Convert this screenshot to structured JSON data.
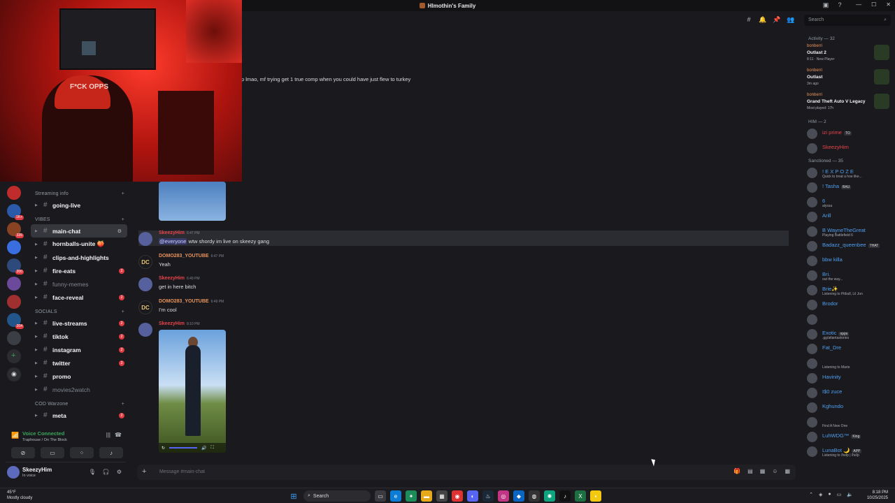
{
  "window": {
    "title": "Hlmothin's Family",
    "controls": [
      "—",
      "☐",
      "✕"
    ]
  },
  "header": {
    "search_placeholder": "Search"
  },
  "webcam": {
    "cap_text": "F*CK OPPS"
  },
  "server_rail": {
    "badges": [
      "",
      "1K+",
      "335",
      "",
      "200",
      "",
      "",
      "204",
      ""
    ]
  },
  "channels": {
    "categories": [
      {
        "name": "Streaming info",
        "items": [
          {
            "name": "going-live",
            "muted": false,
            "badge": ""
          }
        ]
      },
      {
        "name": "VIBES",
        "items": [
          {
            "name": "main-chat",
            "muted": false,
            "badge": "",
            "active": true
          },
          {
            "name": "hornballs-unite 🍑",
            "muted": false,
            "badge": ""
          },
          {
            "name": "clips-and-highlights",
            "muted": false,
            "badge": ""
          },
          {
            "name": "fire-eats",
            "muted": false,
            "badge": "2"
          },
          {
            "name": "funny-memes",
            "muted": true,
            "badge": ""
          },
          {
            "name": "face-reveal",
            "muted": false,
            "badge": "2"
          }
        ]
      },
      {
        "name": "SOCIALS",
        "items": [
          {
            "name": "live-streams",
            "muted": false,
            "badge": "2"
          },
          {
            "name": "tiktok",
            "muted": false,
            "badge": "2"
          },
          {
            "name": "instagram",
            "muted": false,
            "badge": "2"
          },
          {
            "name": "twitter",
            "muted": false,
            "badge": "2"
          },
          {
            "name": "promo",
            "muted": false,
            "badge": ""
          },
          {
            "name": "movies2watch",
            "muted": true,
            "badge": ""
          }
        ]
      },
      {
        "name": "COD Warzone",
        "items": [
          {
            "name": "meta",
            "muted": false,
            "badge": "2"
          }
        ]
      }
    ]
  },
  "voice": {
    "status": "Voice Connected",
    "location": "Traphouse / On The Block"
  },
  "user": {
    "name": "SkeezyHim",
    "status": "In voice"
  },
  "chat": {
    "partial_message": "p lmao, mf trying get 1 true comp when you could have just flew to turkey",
    "messages": [
      {
        "author": "SkeezyHim",
        "color": "#e8434a",
        "time": "6:47 PM",
        "mention": "@everyone",
        "text": " wtw shordy im live on skeezy gang"
      },
      {
        "author": "DOMO283_YOUTUBE",
        "color": "#e8935a",
        "time": "6:47 PM",
        "mention": "",
        "text": "Yeah"
      },
      {
        "author": "SkeezyHim",
        "color": "#e8434a",
        "time": "6:49 PM",
        "mention": "",
        "text": "get in here bitch"
      },
      {
        "author": "DOMO283_YOUTUBE",
        "color": "#e8935a",
        "time": "6:49 PM",
        "mention": "",
        "text": "I'm cool"
      },
      {
        "author": "SkeezyHim",
        "color": "#e8434a",
        "time": "8:10 PM",
        "mention": "",
        "text": ""
      }
    ],
    "input_placeholder": "Message #main-chat"
  },
  "members": {
    "activity_header": "Activity — 32",
    "activities": [
      {
        "user": "bonberri",
        "game": "Outlast 2",
        "detail": "8:11 · New Player"
      },
      {
        "user": "bonberri",
        "game": "Outlast",
        "detail": "3m ago"
      },
      {
        "user": "bonberri",
        "game": "Grand Theft Auto V Legacy",
        "detail": "Most played: 17h"
      }
    ],
    "him_header": "HIM — 2",
    "him": [
      {
        "name": "izi prime",
        "color": "#e8434a",
        "tag": "TO",
        "sub": ""
      },
      {
        "name": "SkeezyHim",
        "color": "#e8434a",
        "tag": "",
        "sub": ""
      }
    ],
    "sanctioned_header": "Sanctioned — 35",
    "sanctioned": [
      {
        "name": "! E X P O Z E",
        "color": "#4f9ff0",
        "tag": "",
        "sub": "Quick to treat a hoe like..."
      },
      {
        "name": "! Tasha",
        "color": "#4f9ff0",
        "tag": "BAU",
        "sub": ""
      },
      {
        "name": "6",
        "color": "#4f9ff0",
        "tag": "",
        "sub": "alyssa"
      },
      {
        "name": "Arill",
        "color": "#4f9ff0",
        "tag": "",
        "sub": ""
      },
      {
        "name": "B WayneTheGreat",
        "color": "#4f9ff0",
        "tag": "",
        "sub": "Playing Battlefield 6"
      },
      {
        "name": "Badazz_queenbee",
        "color": "#4f9ff0",
        "tag": "THAT",
        "sub": ""
      },
      {
        "name": "bbw killa",
        "color": "#4f9ff0",
        "tag": "",
        "sub": ""
      },
      {
        "name": "Bri.",
        "color": "#4f9ff0",
        "tag": "",
        "sub": "out the way..."
      },
      {
        "name": "Brie✨",
        "color": "#4f9ff0",
        "tag": "",
        "sub": "Listening to Pitbull, Lil Jon"
      },
      {
        "name": "Brodor",
        "color": "#4f9ff0",
        "tag": "",
        "sub": ""
      },
      {
        "name": "",
        "color": "#e8434a",
        "tag": "",
        "sub": ""
      },
      {
        "name": "Exotic",
        "color": "#4f9ff0",
        "tag": "opps",
        "sub": ".gg/atlantastories"
      },
      {
        "name": "Fat_Dre",
        "color": "#4f9ff0",
        "tag": "",
        "sub": ""
      },
      {
        "name": "",
        "color": "#e8434a",
        "tag": "",
        "sub": "Listening to Mario"
      },
      {
        "name": "Havinity",
        "color": "#4f9ff0",
        "tag": "",
        "sub": ""
      },
      {
        "name": "I$0 zuce",
        "color": "#4f9ff0",
        "tag": "",
        "sub": ""
      },
      {
        "name": "Kghundo",
        "color": "#4f9ff0",
        "tag": "",
        "sub": ""
      },
      {
        "name": "",
        "color": "#e8434a",
        "tag": "",
        "sub": "Find A New One"
      },
      {
        "name": "LuhWDG™",
        "color": "#4f9ff0",
        "tag": "King",
        "sub": ""
      },
      {
        "name": "LunaBot 🌙",
        "color": "#4f9ff0",
        "tag": "APP",
        "sub": "Listening to /help | /help"
      }
    ]
  },
  "taskbar": {
    "weather_temp": "45°F",
    "weather_desc": "Mostly cloudy",
    "search": "Search",
    "time": "8:18 PM",
    "date": "10/25/2025"
  }
}
